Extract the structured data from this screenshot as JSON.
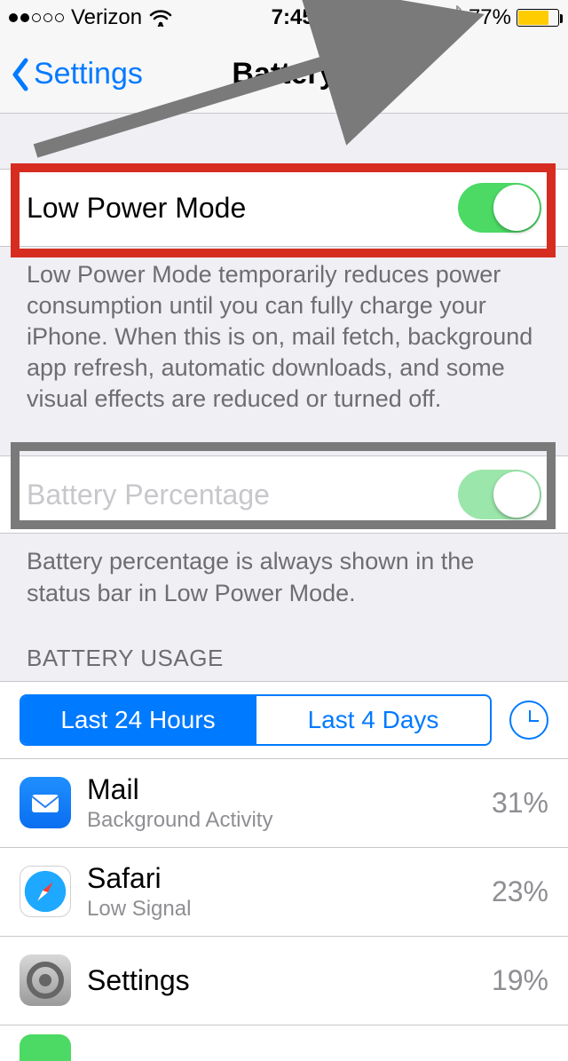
{
  "status": {
    "carrier": "Verizon",
    "time": "7:45 PM",
    "battery_pct": "77%",
    "battery_fill_pct": 77
  },
  "nav": {
    "back_label": "Settings",
    "title": "Battery"
  },
  "low_power": {
    "label": "Low Power Mode",
    "on": true,
    "footer": "Low Power Mode temporarily reduces power consumption until you can fully charge your iPhone. When this is on, mail fetch, background app refresh, automatic downloads, and some visual effects are reduced or turned off."
  },
  "battery_pct_row": {
    "label": "Battery Percentage",
    "on": true,
    "footer": "Battery percentage is always shown in the status bar in Low Power Mode."
  },
  "usage": {
    "header": "BATTERY USAGE",
    "seg1": "Last 24 Hours",
    "seg2": "Last 4 Days",
    "rows": [
      {
        "name": "Mail",
        "sub": "Background Activity",
        "pct": "31%"
      },
      {
        "name": "Safari",
        "sub": "Low Signal",
        "pct": "23%"
      },
      {
        "name": "Settings",
        "sub": "",
        "pct": "19%"
      }
    ]
  }
}
